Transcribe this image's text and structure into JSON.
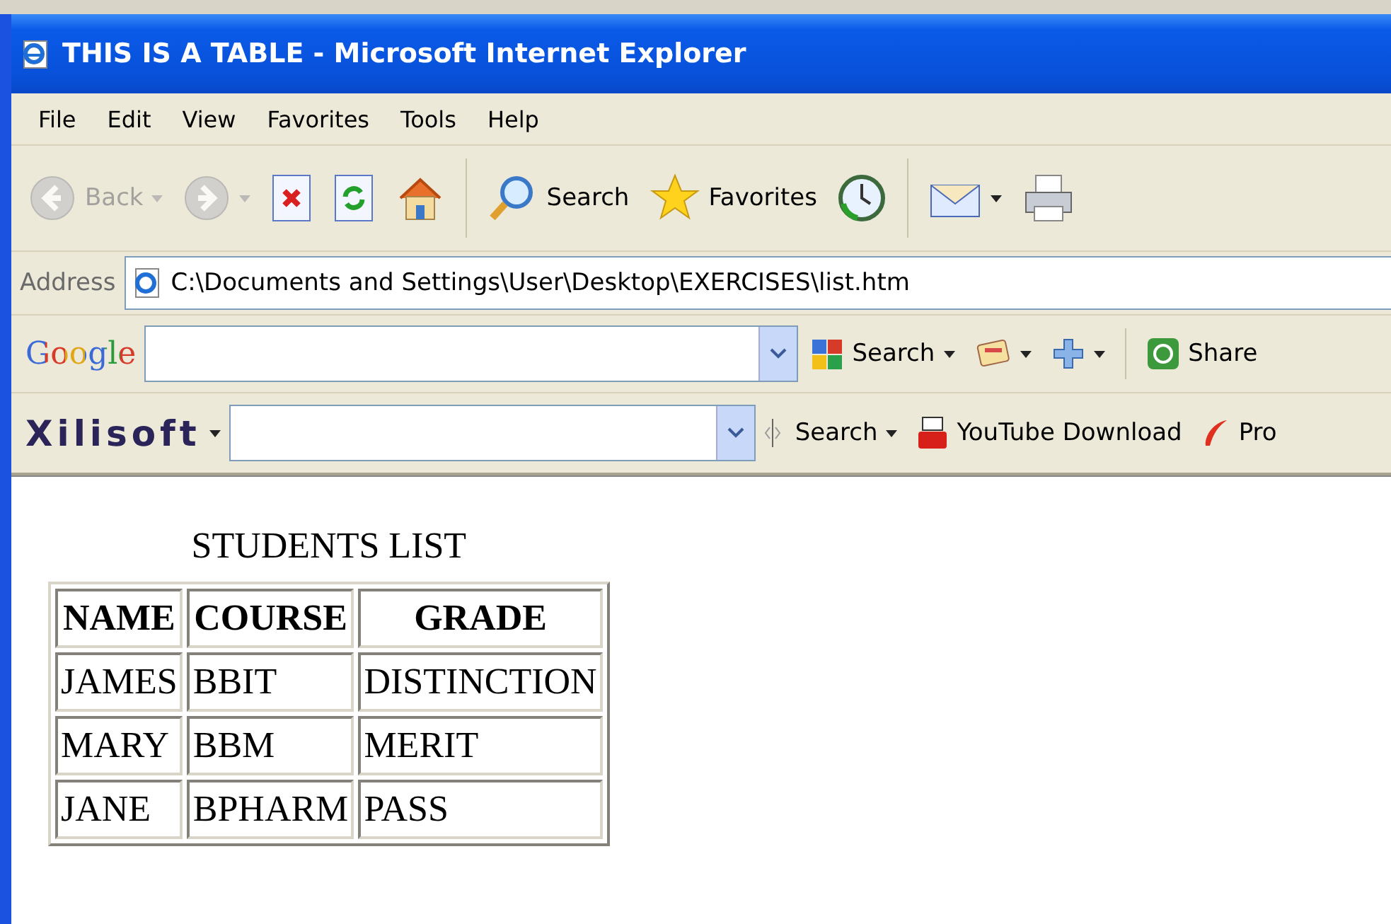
{
  "window": {
    "title": "THIS IS A TABLE - Microsoft Internet Explorer"
  },
  "menu": [
    "File",
    "Edit",
    "View",
    "Favorites",
    "Tools",
    "Help"
  ],
  "toolbar": [
    {
      "kind": "back",
      "label": "Back",
      "disabled": true,
      "dropdown": true
    },
    {
      "kind": "forward",
      "disabled": true,
      "dropdown": true
    },
    {
      "kind": "stop",
      "disabled": false,
      "dropdown": false
    },
    {
      "kind": "refresh",
      "disabled": false,
      "dropdown": false
    },
    {
      "kind": "home",
      "disabled": false,
      "dropdown": false
    },
    {
      "kind": "search",
      "label": "Search",
      "disabled": false,
      "dropdown": false
    },
    {
      "kind": "favorites",
      "label": "Favorites",
      "disabled": false,
      "dropdown": false
    },
    {
      "kind": "history",
      "disabled": false,
      "dropdown": false
    },
    {
      "kind": "mail",
      "disabled": false,
      "dropdown": true
    },
    {
      "kind": "print",
      "disabled": false,
      "dropdown": false
    }
  ],
  "address": {
    "label": "Address",
    "value": "C:\\Documents and Settings\\User\\Desktop\\EXERCISES\\list.htm"
  },
  "google_bar": {
    "logo": "Google",
    "search_label": "Search",
    "share_label": "Share"
  },
  "xilisoft_bar": {
    "logo": "Xilisoft",
    "search_label": "Search",
    "youtube_label": "YouTube Download",
    "product_label": "Pro"
  },
  "page": {
    "heading": "STUDENTS LIST",
    "table": {
      "columns": [
        "NAME",
        "COURSE",
        "GRADE"
      ],
      "rows": [
        [
          "JAMES",
          "BBIT",
          "DISTINCTION"
        ],
        [
          "MARY",
          "BBM",
          "MERIT"
        ],
        [
          "JANE",
          "BPHARM",
          "PASS"
        ]
      ]
    }
  }
}
